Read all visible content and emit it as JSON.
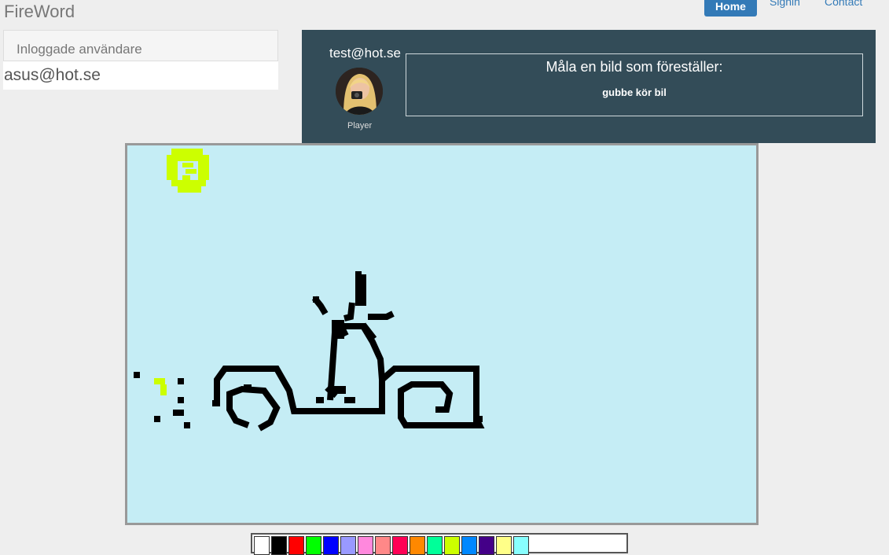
{
  "navbar": {
    "brand": "FireWord",
    "links": [
      "Home",
      "Signin",
      "Contact"
    ],
    "active": "Home"
  },
  "users_panel": {
    "heading": "Inloggade användare",
    "users": [
      "asus@hot.se"
    ]
  },
  "player_panel": {
    "email": "test@hot.se",
    "role": "Player",
    "task_title": "Måla en bild som föreställer:",
    "task_word": "gubbe kör bil"
  },
  "canvas": {
    "background": "#c5edf5",
    "ink_black": "#000000",
    "ink_yellow": "#ccff00"
  },
  "palette": {
    "colors": [
      "#ffffff",
      "#000000",
      "#ff0000",
      "#00ff00",
      "#0000ff",
      "#9999ff",
      "#ff88dd",
      "#ff8888",
      "#ff0055",
      "#ff8800",
      "#00ff99",
      "#ccff00",
      "#0088ff",
      "#440088",
      "#ffff88",
      "#88ffff"
    ]
  }
}
